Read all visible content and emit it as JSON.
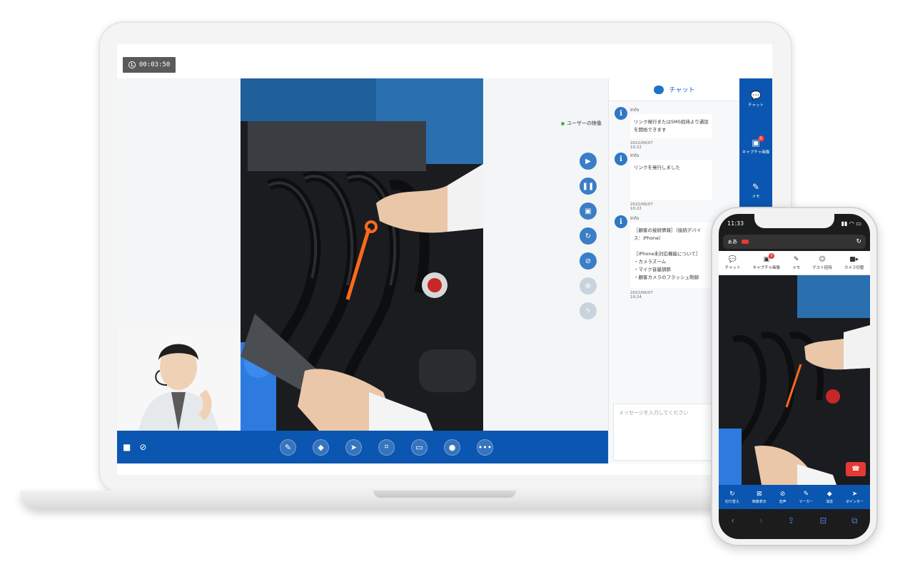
{
  "timer": "00:03:50",
  "user_video_label": "ユーザーの映像",
  "chat": {
    "title": "チャット",
    "messages": [
      {
        "sender": "Info",
        "text": "リンク発行またはSMS招待より通話を開始できます",
        "time": "2022/06/07 10:22"
      },
      {
        "sender": "Info",
        "text": "リンクを発行しました",
        "time": "2022/06/07 10:22"
      },
      {
        "sender": "Info",
        "text": "［顧客の接続情報］（接続デバイス：iPhone）\n\n［iPhone未対応機能について］\n・カメラズーム\n・マイク音量調節\n・顧客カメラのフラッシュ制御",
        "time": "2022/06/07 10:24"
      }
    ],
    "input_placeholder": "メッセージを入力してください"
  },
  "rail": {
    "chat": "チャット",
    "capture": "キャプチャ画像",
    "capture_badge": "0",
    "memo": "メモ"
  },
  "phone": {
    "time": "11:33",
    "url_text": "ぁあ",
    "tabs": {
      "chat": "チャット",
      "capture": "キャプチャ画像",
      "capture_badge": "0",
      "memo": "メモ",
      "guest": "ゲスト招待",
      "camera": "カメラ切替"
    },
    "tools": {
      "switch": "切り替え",
      "video": "映像表示",
      "audio": "音声",
      "marker": "マーカー",
      "erase": "消去",
      "pointer": "ポインター"
    }
  }
}
